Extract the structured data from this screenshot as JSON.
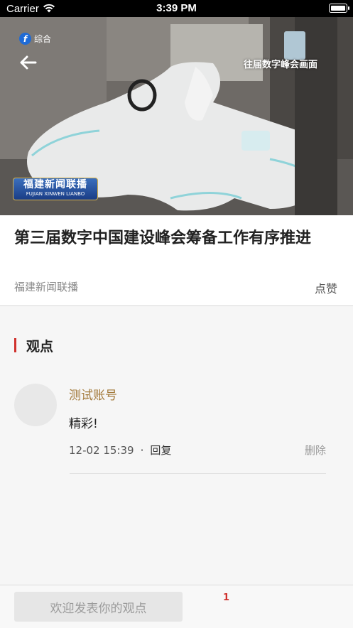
{
  "status_bar": {
    "carrier": "Carrier",
    "time": "3:39 PM"
  },
  "video": {
    "channel_name": "综合",
    "overlay_caption": "往届数字峰会画面",
    "news_logo_cn": "福建新闻联播",
    "news_logo_en": "FUJIAN XINWEN LIANBO"
  },
  "article": {
    "title": "第三届数字中国建设峰会筹备工作有序推进",
    "source": "福建新闻联播",
    "like_label": "点赞"
  },
  "comments_section": {
    "heading": "观点",
    "accent_color": "#d0312d",
    "items": [
      {
        "author": "测试账号",
        "content": "精彩!",
        "time": "12-02 15:39",
        "separator": "·",
        "reply_label": "回复",
        "delete_label": "删除"
      }
    ]
  },
  "bottom_bar": {
    "input_placeholder": "欢迎发表你的观点",
    "comment_count": "1"
  }
}
